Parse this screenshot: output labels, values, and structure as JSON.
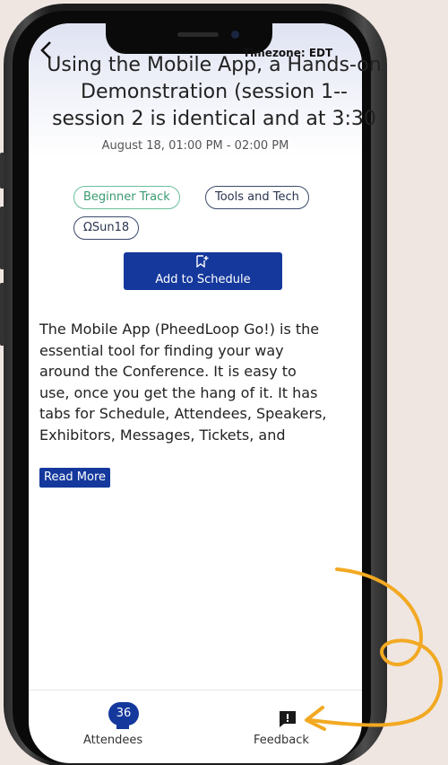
{
  "status": {
    "timezone": "Timezone: EDT"
  },
  "session": {
    "title": "Using the Mobile App, a Hands-on\nDemonstration (session 1--\nsession 2 is identical and at 3:30",
    "datetime": "August 18, 01:00 PM - 02:00 PM",
    "tags": [
      "Beginner Track",
      "Tools and Tech",
      "ΩSun18"
    ],
    "add_label": "Add to Schedule",
    "description": "The Mobile App (PheedLoop Go!) is the\nessential tool for finding your way\naround the Conference.  It is easy to\nuse, once you get the hang of it. It has\ntabs for Schedule, Attendees, Speakers,\nExhibitors, Messages, Tickets, and",
    "read_more": "Read More"
  },
  "tabbar": {
    "attendees_count": "36",
    "attendees_label": "Attendees",
    "feedback_label": "Feedback"
  },
  "colors": {
    "brand": "#14389c",
    "green_chip": "#3a9b70",
    "annotation": "#f2a922"
  },
  "icons": {
    "back": "chevron-left-icon",
    "add_schedule": "bookmark-plus-icon",
    "feedback": "feedback-icon"
  }
}
